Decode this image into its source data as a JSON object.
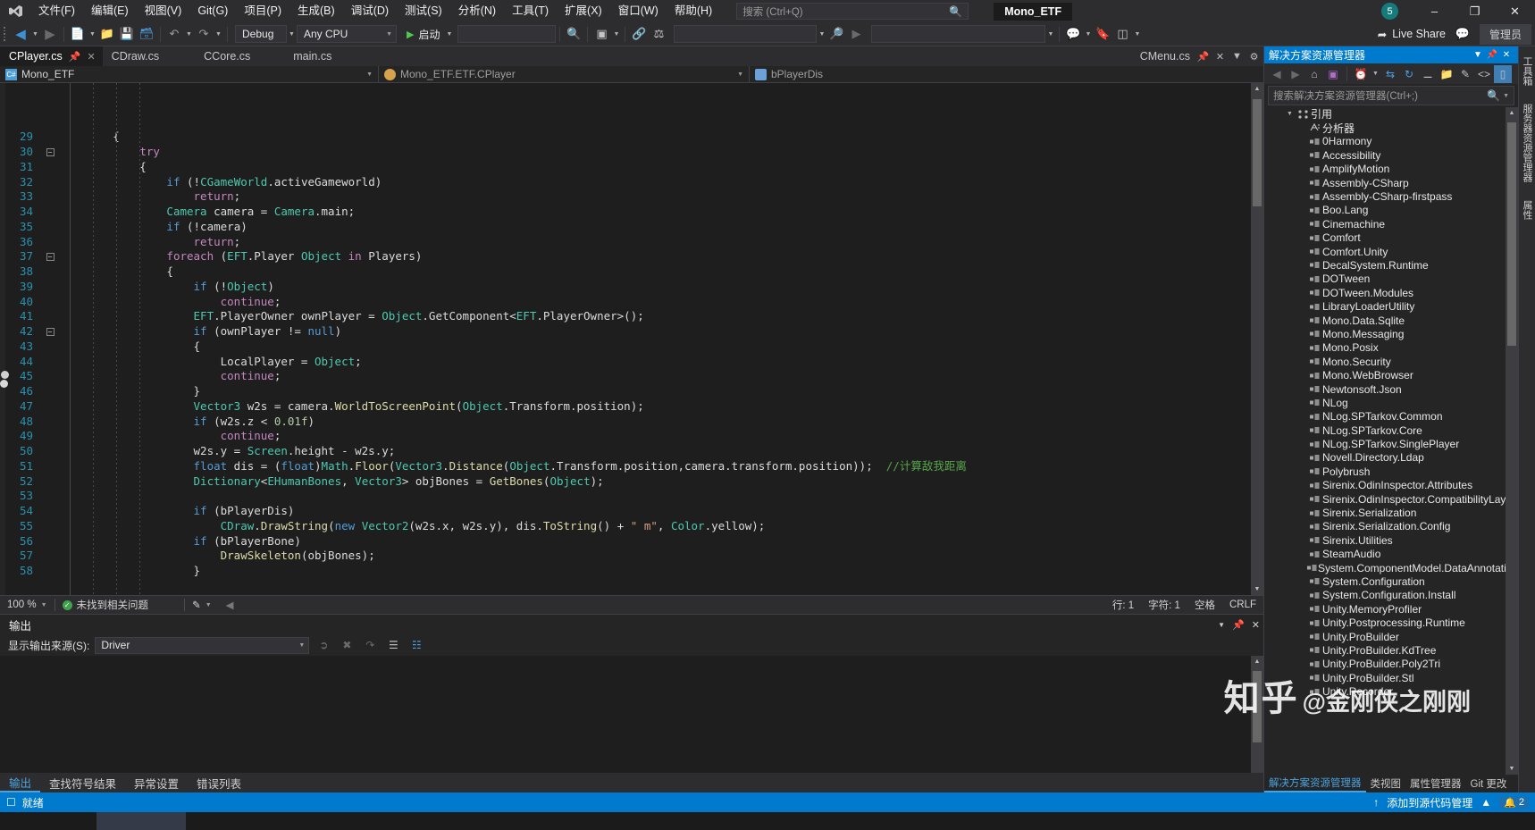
{
  "titlebar": {
    "logo": "vs-logo",
    "menus": [
      {
        "label": "文件(F)"
      },
      {
        "label": "编辑(E)"
      },
      {
        "label": "视图(V)"
      },
      {
        "label": "Git(G)"
      },
      {
        "label": "项目(P)"
      },
      {
        "label": "生成(B)"
      },
      {
        "label": "调试(D)"
      },
      {
        "label": "测试(S)"
      },
      {
        "label": "分析(N)"
      },
      {
        "label": "工具(T)"
      },
      {
        "label": "扩展(X)"
      },
      {
        "label": "窗口(W)"
      },
      {
        "label": "帮助(H)"
      }
    ],
    "search_placeholder": "搜索 (Ctrl+Q)",
    "solution_name": "Mono_ETF",
    "notification_count": "5",
    "minimize": "–",
    "restore": "❐",
    "close": "✕"
  },
  "toolbar": {
    "config": "Debug",
    "platform": "Any CPU",
    "run_label": "启动",
    "target_placeholder": "",
    "search_placeholder2": "",
    "live_share": "Live Share",
    "admin": "管理员"
  },
  "tabs": [
    {
      "label": "CPlayer.cs",
      "active": true
    },
    {
      "label": "CDraw.cs",
      "active": false
    },
    {
      "label": "CCore.cs",
      "active": false
    },
    {
      "label": "main.cs",
      "active": false
    },
    {
      "label": "CMenu.cs",
      "active": false
    }
  ],
  "breadcrumb": {
    "project": "Mono_ETF",
    "type": "Mono_ETF.ETF.CPlayer",
    "member": "bPlayerDis"
  },
  "editor": {
    "lines": [
      {
        "n": "29",
        "fold": "",
        "code": "        {"
      },
      {
        "n": "30",
        "fold": "-",
        "code": "            try"
      },
      {
        "n": "31",
        "fold": "",
        "code": "            {"
      },
      {
        "n": "32",
        "fold": "",
        "code": "                if (!CGameWorld.activeGameworld)"
      },
      {
        "n": "33",
        "fold": "",
        "code": "                    return;"
      },
      {
        "n": "34",
        "fold": "",
        "code": "                Camera camera = Camera.main;"
      },
      {
        "n": "35",
        "fold": "",
        "code": "                if (!camera)"
      },
      {
        "n": "36",
        "fold": "",
        "code": "                    return;"
      },
      {
        "n": "37",
        "fold": "-",
        "code": "                foreach (EFT.Player Object in Players)"
      },
      {
        "n": "38",
        "fold": "",
        "code": "                {"
      },
      {
        "n": "39",
        "fold": "",
        "code": "                    if (!Object)"
      },
      {
        "n": "40",
        "fold": "",
        "code": "                        continue;"
      },
      {
        "n": "41",
        "fold": "",
        "code": "                    EFT.PlayerOwner ownPlayer = Object.GetComponent<EFT.PlayerOwner>();"
      },
      {
        "n": "42",
        "fold": "-",
        "code": "                    if (ownPlayer != null)"
      },
      {
        "n": "43",
        "fold": "",
        "code": "                    {"
      },
      {
        "n": "44",
        "fold": "",
        "code": "                        LocalPlayer = Object;"
      },
      {
        "n": "45",
        "fold": "",
        "code": "                        continue;"
      },
      {
        "n": "46",
        "fold": "",
        "code": "                    }"
      },
      {
        "n": "47",
        "fold": "",
        "code": "                    Vector3 w2s = camera.WorldToScreenPoint(Object.Transform.position);"
      },
      {
        "n": "48",
        "fold": "",
        "code": "                    if (w2s.z < 0.01f)"
      },
      {
        "n": "49",
        "fold": "",
        "code": "                        continue;"
      },
      {
        "n": "50",
        "fold": "",
        "code": "                    w2s.y = Screen.height - w2s.y;"
      },
      {
        "n": "51",
        "fold": "",
        "code": "                    float dis = (float)Math.Floor(Vector3.Distance(Object.Transform.position,camera.transform.position));  //计算敌我距离"
      },
      {
        "n": "52",
        "fold": "",
        "code": "                    Dictionary<EHumanBones, Vector3> objBones = GetBones(Object);"
      },
      {
        "n": "53",
        "fold": "",
        "code": ""
      },
      {
        "n": "54",
        "fold": "",
        "code": "                    if (bPlayerDis)"
      },
      {
        "n": "55",
        "fold": "",
        "code": "                        CDraw.DrawString(new Vector2(w2s.x, w2s.y), dis.ToString() + \" m\", Color.yellow);"
      },
      {
        "n": "56",
        "fold": "",
        "code": "                    if (bPlayerBone)"
      },
      {
        "n": "57",
        "fold": "",
        "code": "                        DrawSkeleton(objBones);"
      },
      {
        "n": "58",
        "fold": "",
        "code": "                    }"
      }
    ],
    "zoom": "100 %",
    "issue_status": "未找到相关问题",
    "row_label": "行: 1",
    "col_label": "字符: 1",
    "indent_label": "空格",
    "eol_label": "CRLF"
  },
  "output": {
    "title": "输出",
    "source_label": "显示输出来源(S):",
    "source_value": "Driver",
    "content": "",
    "tabs": [
      {
        "label": "输出",
        "active": true
      },
      {
        "label": "查找符号结果",
        "active": false
      },
      {
        "label": "异常设置",
        "active": false
      },
      {
        "label": "错误列表",
        "active": false
      }
    ]
  },
  "solution_explorer": {
    "title": "解决方案资源管理器",
    "search_placeholder": "搜索解决方案资源管理器(Ctrl+;)",
    "root": "引用",
    "analyzer": "分析器",
    "items": [
      "0Harmony",
      "Accessibility",
      "AmplifyMotion",
      "Assembly-CSharp",
      "Assembly-CSharp-firstpass",
      "Boo.Lang",
      "Cinemachine",
      "Comfort",
      "Comfort.Unity",
      "DecalSystem.Runtime",
      "DOTween",
      "DOTween.Modules",
      "LibraryLoaderUtility",
      "Mono.Data.Sqlite",
      "Mono.Messaging",
      "Mono.Posix",
      "Mono.Security",
      "Mono.WebBrowser",
      "Newtonsoft.Json",
      "NLog",
      "NLog.SPTarkov.Common",
      "NLog.SPTarkov.Core",
      "NLog.SPTarkov.SinglePlayer",
      "Novell.Directory.Ldap",
      "Polybrush",
      "Sirenix.OdinInspector.Attributes",
      "Sirenix.OdinInspector.CompatibilityLayer",
      "Sirenix.Serialization",
      "Sirenix.Serialization.Config",
      "Sirenix.Utilities",
      "SteamAudio",
      "System.ComponentModel.DataAnnotations",
      "System.Configuration",
      "System.Configuration.Install",
      "Unity.MemoryProfiler",
      "Unity.Postprocessing.Runtime",
      "Unity.ProBuilder",
      "Unity.ProBuilder.KdTree",
      "Unity.ProBuilder.Poly2Tri",
      "Unity.ProBuilder.Stl",
      "Unity.Recorder"
    ],
    "bottom_tabs": [
      {
        "label": "解决方案资源管理器",
        "active": true
      },
      {
        "label": "类视图",
        "active": false
      },
      {
        "label": "属性管理器",
        "active": false
      },
      {
        "label": "Git 更改",
        "active": false
      }
    ]
  },
  "far_right_tabs": [
    "工具箱",
    "服务器资源管理器",
    "属性"
  ],
  "statusbar": {
    "ready": "就绪",
    "up_arrow": "↑",
    "source_control": "添加到源代码管理",
    "bell_count": "2"
  },
  "watermark": {
    "main": "知乎",
    "sub": "@金刚侠之刚刚"
  }
}
